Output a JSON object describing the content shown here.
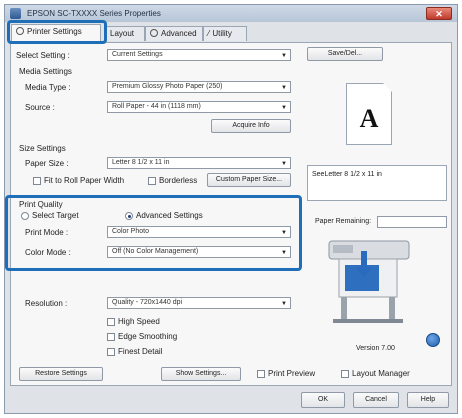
{
  "window": {
    "title": "EPSON SC-TXXXX Series Properties",
    "close_glyph": "✕"
  },
  "tabs": [
    {
      "label": "Printer Settings"
    },
    {
      "label": "Layout"
    },
    {
      "label": "Advanced"
    },
    {
      "label": "Utility"
    }
  ],
  "select_setting": {
    "label": "Select Setting :",
    "value": "Current Settings",
    "saveel_label": "Save/Del..."
  },
  "media": {
    "group_label": "Media Settings",
    "media_type_label": "Media Type :",
    "media_type_value": "Premium Glossy Photo Paper (250)",
    "source_label": "Source :",
    "source_value": "Roll Paper - 44 in (1118 mm)",
    "acquire_label": "Acquire Info"
  },
  "size": {
    "group_label": "Size Settings",
    "paper_size_label": "Paper Size :",
    "paper_size_value": "Letter 8 1/2 x 11 in",
    "fit_label": "Fit to Roll Paper Width",
    "borderless_label": "Borderless",
    "custom_label": "Custom Paper Size..."
  },
  "quality": {
    "group_label": "Print Quality",
    "select_target_label": "Select Target",
    "advanced_label": "Advanced Settings",
    "print_mode_label": "Print Mode :",
    "print_mode_value": "Color Photo",
    "color_mode_label": "Color Mode :",
    "color_mode_value": "Off (No Color Management)",
    "resolution_label": "Resolution :",
    "resolution_value": "Quality - 720x1440 dpi",
    "high_speed_label": "High Speed",
    "edge_label": "Edge Smoothing",
    "finest_label": "Finest Detail"
  },
  "preview": {
    "letter_glyph": "A",
    "size_text": "SeeLetter 8 1/2 x 11 in",
    "paper_remaining_label": "Paper Remaining:",
    "version": "Version 7.00"
  },
  "bottom": {
    "restore_label": "Restore Settings",
    "show_settings_label": "Show Settings...",
    "print_preview_label": "Print Preview",
    "layout_manager_label": "Layout Manager"
  },
  "footer": {
    "ok_label": "OK",
    "cancel_label": "Cancel",
    "help_label": "Help"
  },
  "colors": {
    "highlight": "#1f6fb8",
    "titlebar": "#b7c6d8",
    "close": "#c0392b"
  }
}
